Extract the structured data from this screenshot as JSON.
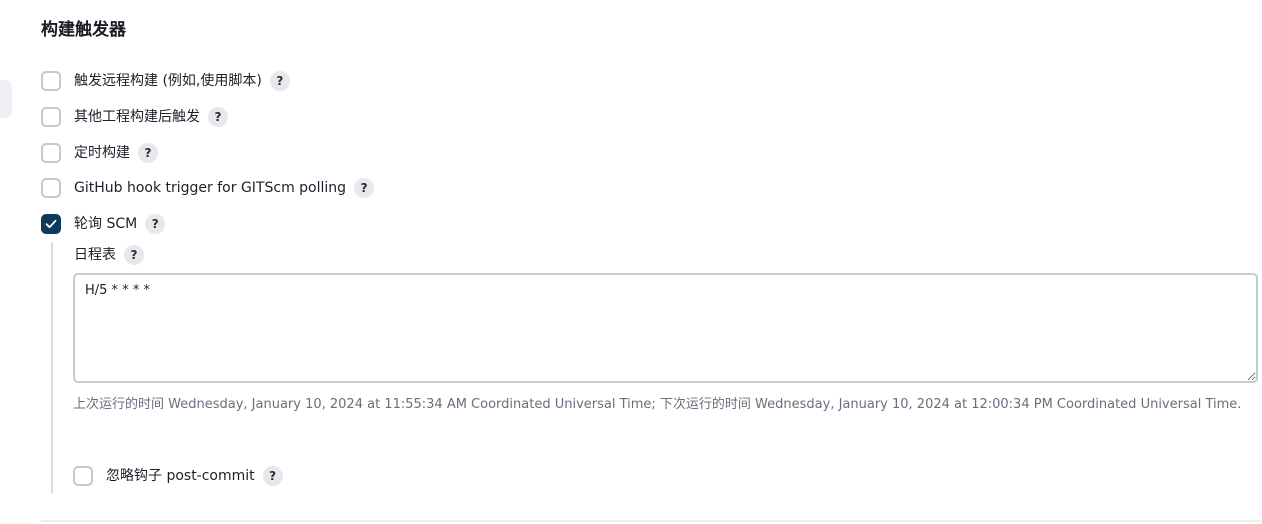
{
  "section": {
    "title": "构建触发器"
  },
  "triggers": [
    {
      "label": "触发远程构建 (例如,使用脚本)",
      "checked": false,
      "help": "?"
    },
    {
      "label": "其他工程构建后触发",
      "checked": false,
      "help": "?"
    },
    {
      "label": "定时构建",
      "checked": false,
      "help": "?"
    },
    {
      "label": "GitHub hook trigger for GITScm polling",
      "checked": false,
      "help": "?"
    },
    {
      "label": "轮询 SCM",
      "checked": true,
      "help": "?"
    }
  ],
  "poll_scm": {
    "schedule_label": "日程表",
    "schedule_help": "?",
    "schedule_value": "H/5 * * * *",
    "hint": "上次运行的时间 Wednesday, January 10, 2024 at 11:55:34 AM Coordinated Universal Time; 下次运行的时间 Wednesday, January 10, 2024 at 12:00:34 PM Coordinated Universal Time.",
    "ignore_hooks": {
      "label": "忽略钩子 post-commit",
      "checked": false,
      "help": "?"
    }
  },
  "colors": {
    "checkbox_checked": "#0e3a5c",
    "checkbox_border": "#c6c8cf",
    "hint_text": "#6b6e7d"
  },
  "icons": {
    "check": "check-icon",
    "help": "help-icon",
    "resize": "resize-grip-icon"
  }
}
